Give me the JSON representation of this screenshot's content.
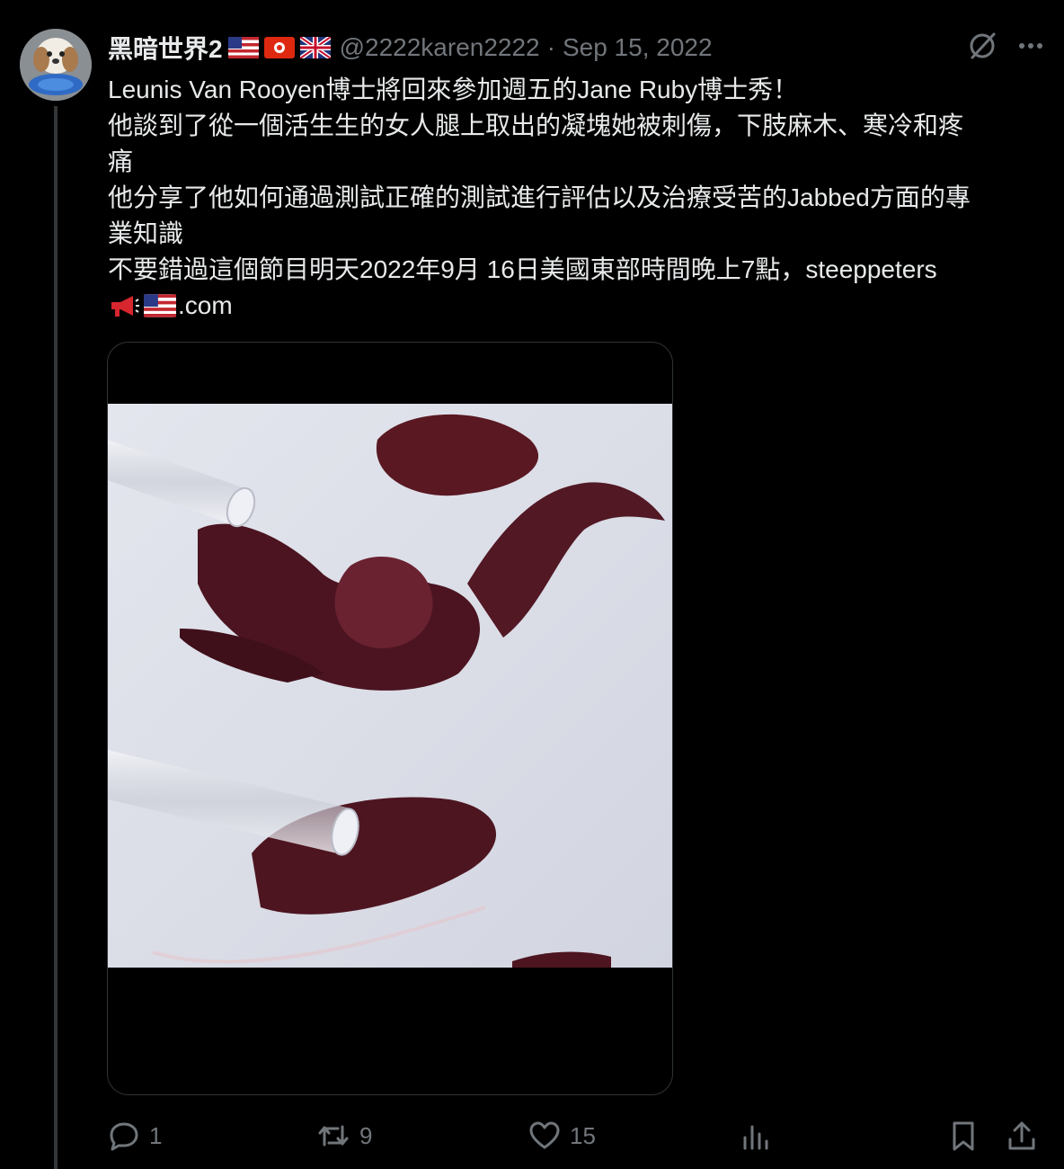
{
  "post": {
    "display_name": "黑暗世界2",
    "handle": "@2222karen2222",
    "separator": "·",
    "date": "Sep 15, 2022",
    "text_lines": [
      "Leunis Van Rooyen博士將回來參加週五的Jane Ruby博士秀！",
      "他談到了從一個活生生的女人腿上取出的凝塊她被刺傷，下肢麻木、寒冷和疼",
      "痛",
      "他分享了他如何通過測試正確的測試進行評估以及治療受苦的Jabbed方面的專",
      "業知識",
      "不要錯過這個節目明天2022年9月 16日美國東部時間晚上7點，steeppeters",
      ".com"
    ],
    "icons": {
      "flags": [
        "us-flag-icon",
        "hong-kong-flag-icon",
        "uk-flag-icon"
      ],
      "inline_emoji": [
        "megaphone-icon",
        "us-flag-icon"
      ]
    }
  },
  "actions": {
    "replies": "1",
    "reposts": "9",
    "likes": "15"
  },
  "colors": {
    "background": "#000000",
    "text": "#e7e9ea",
    "secondary": "#71767b",
    "border": "#2f3336"
  }
}
